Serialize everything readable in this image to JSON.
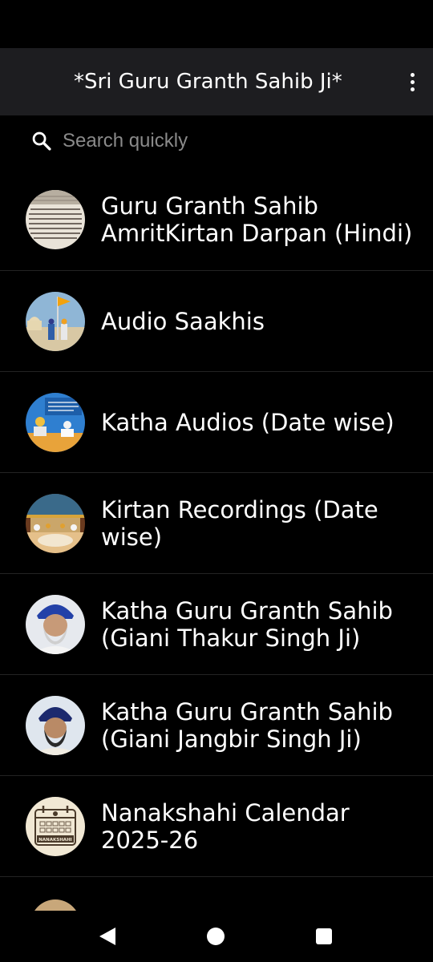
{
  "app_bar": {
    "title": "*Sri Guru Granth Sahib Ji*",
    "menu_icon": "more-vert-icon"
  },
  "search": {
    "placeholder": "Search quickly",
    "value": "",
    "icon": "search-icon"
  },
  "items": [
    {
      "label": "Guru Granth Sahib AmritKirtan Darpan (Hindi)",
      "thumbnail": "manuscript-page"
    },
    {
      "label": "Audio Saakhis",
      "thumbnail": "gurdwara-nishan-sahib"
    },
    {
      "label": "Katha Audios (Date wise)",
      "thumbnail": "katha-banner"
    },
    {
      "label": "Kirtan Recordings (Date wise)",
      "thumbnail": "darbar-sahib-interior"
    },
    {
      "label": "Katha Guru Granth Sahib (Giani Thakur Singh Ji)",
      "thumbnail": "portrait-blue-turban"
    },
    {
      "label": "Katha Guru Granth Sahib (Giani Jangbir Singh Ji)",
      "thumbnail": "portrait-navy-turban"
    },
    {
      "label": "Nanakshahi Calendar 2025-26",
      "thumbnail": "nanakshahi-calendar",
      "badge_text": "NANAKSHAHI"
    }
  ],
  "nav": {
    "back_icon": "back-icon",
    "home_icon": "home-icon",
    "recents_icon": "recents-icon"
  },
  "colors": {
    "background": "#000000",
    "app_bar": "#1d1d20",
    "divider": "#232323",
    "placeholder": "#8a8a8a",
    "text": "#ffffff"
  }
}
